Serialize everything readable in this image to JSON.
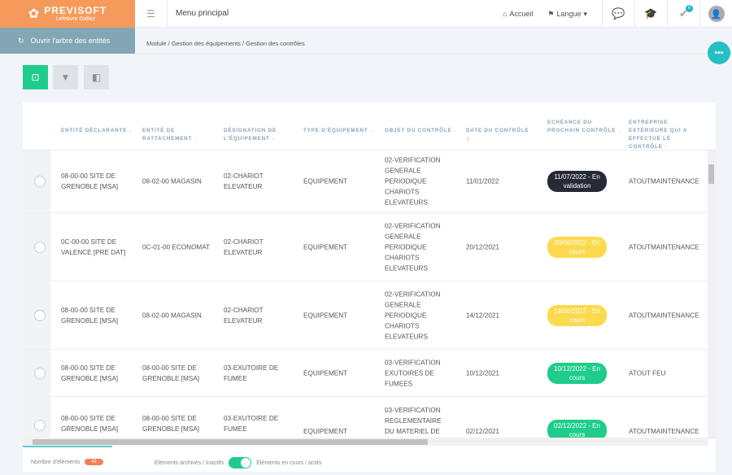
{
  "logo": {
    "name": "PREVISOFT",
    "sub": "Lefebvre Dalloz"
  },
  "header": {
    "menu_title": "Menu principal",
    "home": "Accueil",
    "language": "Langue",
    "notif_count": "0"
  },
  "sidebar": {
    "tree_button": "Ouvrir l'arbre des entités"
  },
  "breadcrumb": "Module / Gestion des équipements / Gestion des contrôles",
  "fab": "•••",
  "columns": [
    {
      "label": "Entité déclarante",
      "sort": "↓"
    },
    {
      "label": "Entité de rattachement",
      "sort": "↓"
    },
    {
      "label": "Désignation de l'équipement",
      "sort": "↓"
    },
    {
      "label": "Type d'équipement",
      "sort": "↓"
    },
    {
      "label": "Objet du contrôle",
      "sort": "↓"
    },
    {
      "label": "Date du contrôle",
      "sort": "↑"
    },
    {
      "label": "Echéance du prochain contrôle",
      "sort": "↓"
    },
    {
      "label": "Entreprise extérieure qui a effectué le contrôle",
      "sort": "↓"
    }
  ],
  "rows": [
    {
      "c": [
        "08-00-00 SITE DE GRENOBLE [MSA]",
        "08-02-00 MAGASIN",
        "02-CHARIOT ELEVATEUR",
        "EQUIPEMENT",
        "02-VERIFICATION GENERALE PERIODIQUE CHARIOTS ELEVATEURS",
        "11/01/2022"
      ],
      "status": "11/07/2022 - En validation",
      "status_color": "#252a34",
      "company": "ATOUTMAINTENANCE"
    },
    {
      "c": [
        "0C-00-00 SITE DE VALENCE [PRE DAT]",
        "0C-01-00 ECONOMAT",
        "02-CHARIOT ELEVATEUR",
        "EQUIPEMENT",
        "02-VERIFICATION GENERALE PERIODIQUE CHARIOTS ELEVATEURS",
        "20/12/2021"
      ],
      "status": "20/06/2022 - En cours",
      "status_color": "#fdd94e",
      "company": "ATOUTMAINTENANCE"
    },
    {
      "c": [
        "08-00-00 SITE DE GRENOBLE [MSA]",
        "08-02-00 MAGASIN",
        "02-CHARIOT ELEVATEUR",
        "EQUIPEMENT",
        "02-VERIFICATION GENERALE PERIODIQUE CHARIOTS ELEVATEURS",
        "14/12/2021"
      ],
      "status": "14/06/2022 - En cours",
      "status_color": "#fdd94e",
      "company": "ATOUTMAINTENANCE"
    },
    {
      "c": [
        "08-00-00 SITE DE GRENOBLE [MSA]",
        "08-00-00 SITE DE GRENOBLE [MSA]",
        "03-EXUTOIRE DE FUMEE",
        "EQUIPEMENT",
        "03-VERIFICATION EXUTOIRES DE FUMEES",
        "10/12/2021"
      ],
      "status": "10/12/2022 - En cours",
      "status_color": "#1fcc8c",
      "company": "ATOUT FEU"
    },
    {
      "c": [
        "08-00-00 SITE DE GRENOBLE [MSA]",
        "08-00-00 SITE DE GRENOBLE [MSA]",
        "03-EXUTOIRE DE FUMEE",
        "EQUIPEMENT",
        "03-VERIFICATION REGLEMENTAIRE DU MATERIEL DE",
        "02/12/2021"
      ],
      "status": "02/12/2022 - En cours",
      "status_color": "#1fcc8c",
      "company": "ATOUTMAINTENANCE"
    }
  ],
  "footer": {
    "count_label": "Nombre d'éléments",
    "count": "41",
    "archived_label": "Eléments archivés / Inactifs",
    "active_label": "Eléments en cours / actifs"
  }
}
